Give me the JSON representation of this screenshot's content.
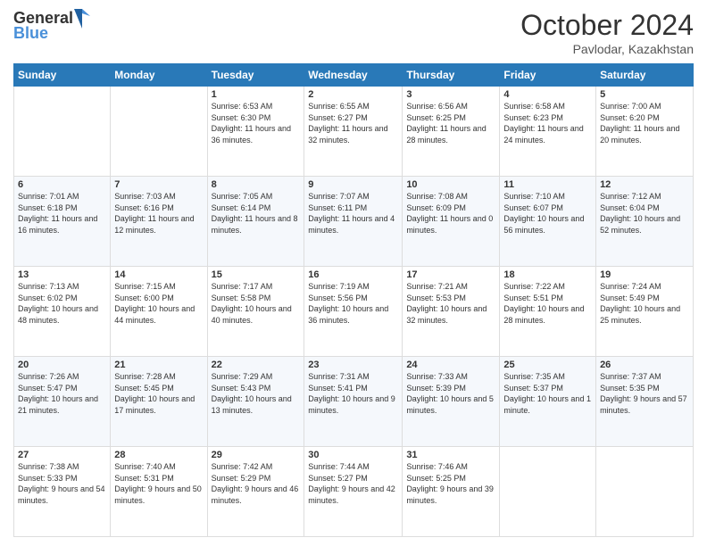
{
  "header": {
    "logo_general": "General",
    "logo_blue": "Blue",
    "month": "October 2024",
    "location": "Pavlodar, Kazakhstan"
  },
  "weekdays": [
    "Sunday",
    "Monday",
    "Tuesday",
    "Wednesday",
    "Thursday",
    "Friday",
    "Saturday"
  ],
  "weeks": [
    [
      {
        "day": "",
        "sunrise": "",
        "sunset": "",
        "daylight": ""
      },
      {
        "day": "",
        "sunrise": "",
        "sunset": "",
        "daylight": ""
      },
      {
        "day": "1",
        "sunrise": "Sunrise: 6:53 AM",
        "sunset": "Sunset: 6:30 PM",
        "daylight": "Daylight: 11 hours and 36 minutes."
      },
      {
        "day": "2",
        "sunrise": "Sunrise: 6:55 AM",
        "sunset": "Sunset: 6:27 PM",
        "daylight": "Daylight: 11 hours and 32 minutes."
      },
      {
        "day": "3",
        "sunrise": "Sunrise: 6:56 AM",
        "sunset": "Sunset: 6:25 PM",
        "daylight": "Daylight: 11 hours and 28 minutes."
      },
      {
        "day": "4",
        "sunrise": "Sunrise: 6:58 AM",
        "sunset": "Sunset: 6:23 PM",
        "daylight": "Daylight: 11 hours and 24 minutes."
      },
      {
        "day": "5",
        "sunrise": "Sunrise: 7:00 AM",
        "sunset": "Sunset: 6:20 PM",
        "daylight": "Daylight: 11 hours and 20 minutes."
      }
    ],
    [
      {
        "day": "6",
        "sunrise": "Sunrise: 7:01 AM",
        "sunset": "Sunset: 6:18 PM",
        "daylight": "Daylight: 11 hours and 16 minutes."
      },
      {
        "day": "7",
        "sunrise": "Sunrise: 7:03 AM",
        "sunset": "Sunset: 6:16 PM",
        "daylight": "Daylight: 11 hours and 12 minutes."
      },
      {
        "day": "8",
        "sunrise": "Sunrise: 7:05 AM",
        "sunset": "Sunset: 6:14 PM",
        "daylight": "Daylight: 11 hours and 8 minutes."
      },
      {
        "day": "9",
        "sunrise": "Sunrise: 7:07 AM",
        "sunset": "Sunset: 6:11 PM",
        "daylight": "Daylight: 11 hours and 4 minutes."
      },
      {
        "day": "10",
        "sunrise": "Sunrise: 7:08 AM",
        "sunset": "Sunset: 6:09 PM",
        "daylight": "Daylight: 11 hours and 0 minutes."
      },
      {
        "day": "11",
        "sunrise": "Sunrise: 7:10 AM",
        "sunset": "Sunset: 6:07 PM",
        "daylight": "Daylight: 10 hours and 56 minutes."
      },
      {
        "day": "12",
        "sunrise": "Sunrise: 7:12 AM",
        "sunset": "Sunset: 6:04 PM",
        "daylight": "Daylight: 10 hours and 52 minutes."
      }
    ],
    [
      {
        "day": "13",
        "sunrise": "Sunrise: 7:13 AM",
        "sunset": "Sunset: 6:02 PM",
        "daylight": "Daylight: 10 hours and 48 minutes."
      },
      {
        "day": "14",
        "sunrise": "Sunrise: 7:15 AM",
        "sunset": "Sunset: 6:00 PM",
        "daylight": "Daylight: 10 hours and 44 minutes."
      },
      {
        "day": "15",
        "sunrise": "Sunrise: 7:17 AM",
        "sunset": "Sunset: 5:58 PM",
        "daylight": "Daylight: 10 hours and 40 minutes."
      },
      {
        "day": "16",
        "sunrise": "Sunrise: 7:19 AM",
        "sunset": "Sunset: 5:56 PM",
        "daylight": "Daylight: 10 hours and 36 minutes."
      },
      {
        "day": "17",
        "sunrise": "Sunrise: 7:21 AM",
        "sunset": "Sunset: 5:53 PM",
        "daylight": "Daylight: 10 hours and 32 minutes."
      },
      {
        "day": "18",
        "sunrise": "Sunrise: 7:22 AM",
        "sunset": "Sunset: 5:51 PM",
        "daylight": "Daylight: 10 hours and 28 minutes."
      },
      {
        "day": "19",
        "sunrise": "Sunrise: 7:24 AM",
        "sunset": "Sunset: 5:49 PM",
        "daylight": "Daylight: 10 hours and 25 minutes."
      }
    ],
    [
      {
        "day": "20",
        "sunrise": "Sunrise: 7:26 AM",
        "sunset": "Sunset: 5:47 PM",
        "daylight": "Daylight: 10 hours and 21 minutes."
      },
      {
        "day": "21",
        "sunrise": "Sunrise: 7:28 AM",
        "sunset": "Sunset: 5:45 PM",
        "daylight": "Daylight: 10 hours and 17 minutes."
      },
      {
        "day": "22",
        "sunrise": "Sunrise: 7:29 AM",
        "sunset": "Sunset: 5:43 PM",
        "daylight": "Daylight: 10 hours and 13 minutes."
      },
      {
        "day": "23",
        "sunrise": "Sunrise: 7:31 AM",
        "sunset": "Sunset: 5:41 PM",
        "daylight": "Daylight: 10 hours and 9 minutes."
      },
      {
        "day": "24",
        "sunrise": "Sunrise: 7:33 AM",
        "sunset": "Sunset: 5:39 PM",
        "daylight": "Daylight: 10 hours and 5 minutes."
      },
      {
        "day": "25",
        "sunrise": "Sunrise: 7:35 AM",
        "sunset": "Sunset: 5:37 PM",
        "daylight": "Daylight: 10 hours and 1 minute."
      },
      {
        "day": "26",
        "sunrise": "Sunrise: 7:37 AM",
        "sunset": "Sunset: 5:35 PM",
        "daylight": "Daylight: 9 hours and 57 minutes."
      }
    ],
    [
      {
        "day": "27",
        "sunrise": "Sunrise: 7:38 AM",
        "sunset": "Sunset: 5:33 PM",
        "daylight": "Daylight: 9 hours and 54 minutes."
      },
      {
        "day": "28",
        "sunrise": "Sunrise: 7:40 AM",
        "sunset": "Sunset: 5:31 PM",
        "daylight": "Daylight: 9 hours and 50 minutes."
      },
      {
        "day": "29",
        "sunrise": "Sunrise: 7:42 AM",
        "sunset": "Sunset: 5:29 PM",
        "daylight": "Daylight: 9 hours and 46 minutes."
      },
      {
        "day": "30",
        "sunrise": "Sunrise: 7:44 AM",
        "sunset": "Sunset: 5:27 PM",
        "daylight": "Daylight: 9 hours and 42 minutes."
      },
      {
        "day": "31",
        "sunrise": "Sunrise: 7:46 AM",
        "sunset": "Sunset: 5:25 PM",
        "daylight": "Daylight: 9 hours and 39 minutes."
      },
      {
        "day": "",
        "sunrise": "",
        "sunset": "",
        "daylight": ""
      },
      {
        "day": "",
        "sunrise": "",
        "sunset": "",
        "daylight": ""
      }
    ]
  ]
}
